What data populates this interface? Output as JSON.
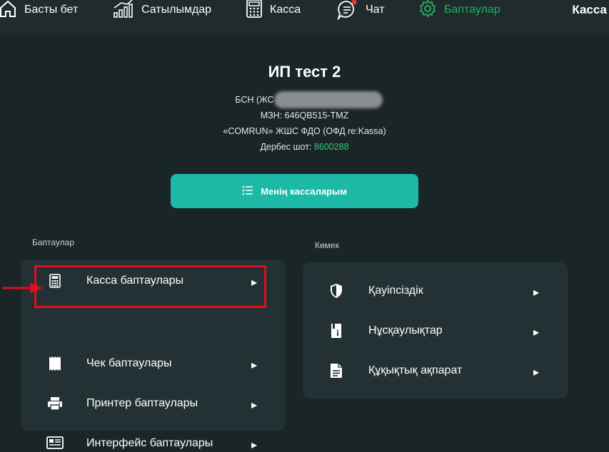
{
  "nav": {
    "home_label": "Басты бет",
    "sales_label": "Сатылымдар",
    "kassa_label": "Касса",
    "chat_label": "Чат",
    "settings_label": "Баптаулар",
    "brand": "Касса"
  },
  "company": {
    "title": "ИП тест 2",
    "bin_prefix": "БСН (ЖС",
    "mzn": "МЗН: 646QB515-TMZ",
    "ofd": "«COMRUN» ЖШС ФДО (ОФД re:Kassa)",
    "personal_account_label": "Дербес шот:",
    "personal_account_value": "8600288"
  },
  "my_kassas_button": "Менің кассаларым",
  "settings_section": {
    "title": "Баптаулар",
    "items": [
      {
        "label": "Касса баптаулары",
        "icon": "calculator-icon"
      },
      {
        "label": "Чек баптаулары",
        "icon": "receipt-icon"
      },
      {
        "label": "Принтер баптаулары",
        "icon": "printer-icon"
      },
      {
        "label": "Интерфейс баптаулары",
        "icon": "interface-icon"
      }
    ]
  },
  "help_section": {
    "title": "Көмек",
    "items": [
      {
        "label": "Қауіпсіздік",
        "icon": "shield-icon"
      },
      {
        "label": "Нұсқаулықтар",
        "icon": "manual-icon"
      },
      {
        "label": "Құқықтық ақпарат",
        "icon": "document-icon"
      }
    ]
  },
  "colors": {
    "accent": "#1bb9a6",
    "active_nav": "#27ae60",
    "highlight": "#e0101a",
    "background": "#1a2528",
    "panel": "#243134"
  }
}
